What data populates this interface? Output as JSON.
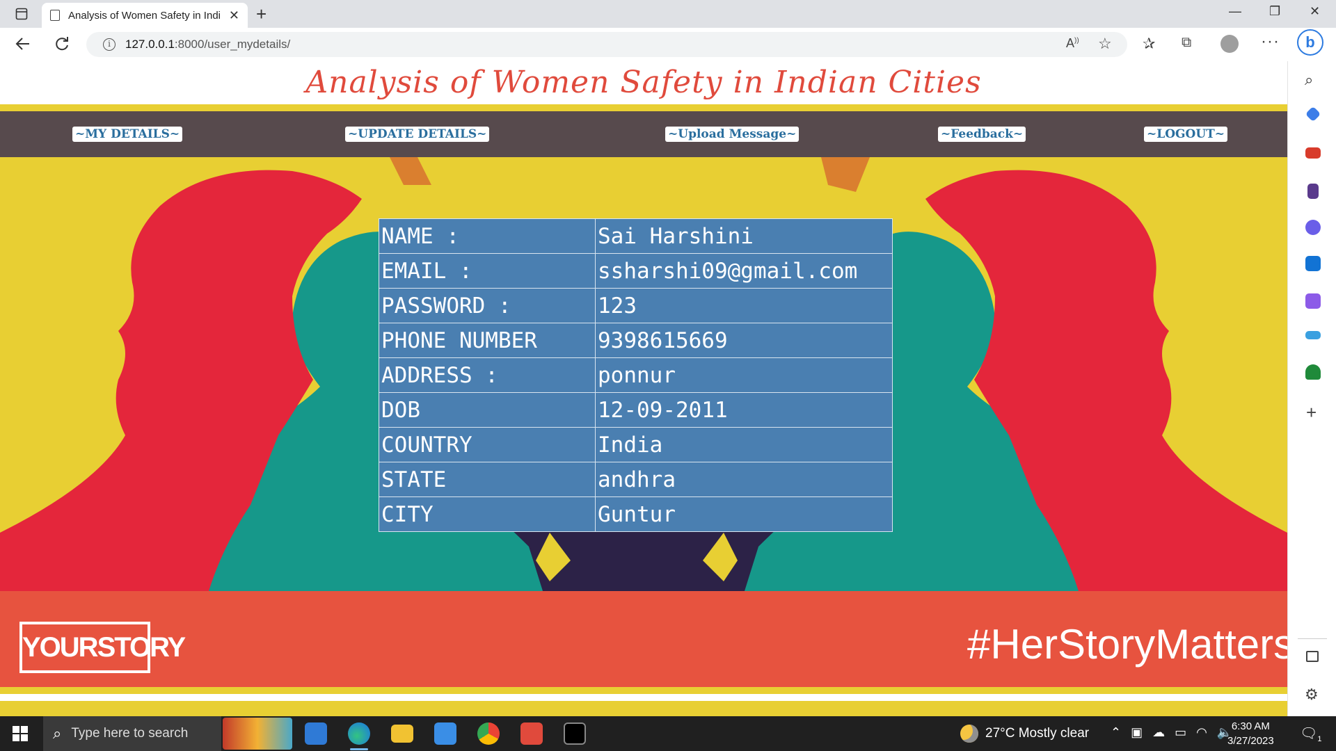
{
  "browser": {
    "tab_title": "Analysis of Women Safety in Indi",
    "tab_close": "✕",
    "new_tab": "+",
    "url_host": "127.0.0.1",
    "url_path": ":8000/user_mydetails/",
    "window_minimize": "—",
    "window_restore": "❐",
    "window_close": "✕"
  },
  "page": {
    "site_title": "Analysis of Women Safety in Indian Cities",
    "menu": [
      {
        "label": "~MY DETAILS~"
      },
      {
        "label": "~UPDATE DETAILS~"
      },
      {
        "label": "~Upload Message~"
      },
      {
        "label": "~Feedback~"
      },
      {
        "label": "~LOGOUT~"
      }
    ],
    "details": [
      {
        "key": "NAME :",
        "value": "Sai Harshini"
      },
      {
        "key": "EMAIL :",
        "value": "ssharshi09@gmail.com"
      },
      {
        "key": "PASSWORD :",
        "value": "123"
      },
      {
        "key": "PHONE NUMBER",
        "value": "9398615669"
      },
      {
        "key": "ADDRESS :",
        "value": "ponnur"
      },
      {
        "key": "DOB",
        "value": "12-09-2011"
      },
      {
        "key": "COUNTRY",
        "value": "India"
      },
      {
        "key": "STATE",
        "value": "andhra"
      },
      {
        "key": "CITY",
        "value": "Guntur"
      }
    ],
    "background_logo": "YOURSTORY",
    "background_hashtag": "#HerStoryMatters"
  },
  "taskbar": {
    "search_placeholder": "Type here to search",
    "weather": "27°C  Mostly clear",
    "time": "6:30 AM",
    "date": "3/27/2023",
    "notification_count": "1"
  },
  "colors": {
    "accent_red": "#e04a3c",
    "menu_bar": "#574a4d",
    "table_bg": "#4a7fb1",
    "page_yellow": "#e8cf33"
  }
}
